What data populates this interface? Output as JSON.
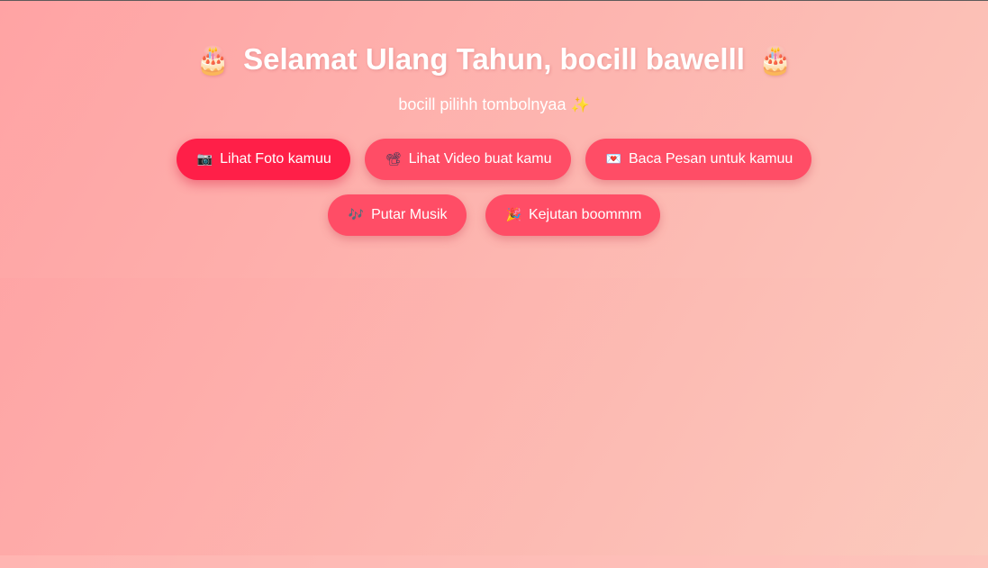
{
  "header": {
    "title": "Selamat Ulang Tahun, bocill bawelll",
    "title_icon": "🎂",
    "subtitle": "bocill pilihh tombolnyaa",
    "subtitle_icon": "✨"
  },
  "buttons": {
    "row1": [
      {
        "icon": "📷",
        "icon_name": "camera-icon",
        "label": "Lihat Foto kamuu",
        "active": true
      },
      {
        "icon": "📽",
        "icon_name": "projector-icon",
        "label": "Lihat Video buat kamu",
        "active": false
      },
      {
        "icon": "💌",
        "icon_name": "love-letter-icon",
        "label": "Baca Pesan untuk kamuu",
        "active": false
      }
    ],
    "row2": [
      {
        "icon": "🎶",
        "icon_name": "music-notes-icon",
        "label": "Putar Musik",
        "active": false
      },
      {
        "icon": "🎉",
        "icon_name": "party-popper-icon",
        "label": "Kejutan boommm",
        "active": false
      }
    ]
  },
  "colors": {
    "button": "#ff4d66",
    "button_active": "#ff1f48",
    "background_start": "#ffa3a4",
    "background_end": "#fbcabd",
    "text": "#ffffff"
  }
}
